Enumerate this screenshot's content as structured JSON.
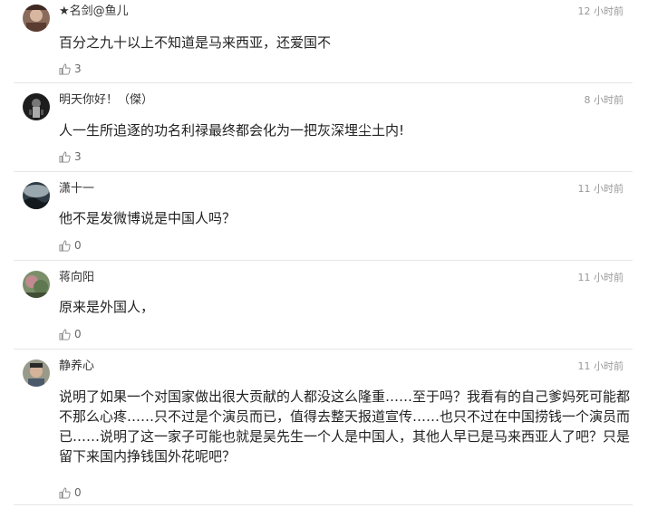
{
  "comments": [
    {
      "username": "★名剑@鱼儿",
      "time": "12 小时前",
      "content": "百分之九十以上不知道是马来西亚，还爱国不",
      "likes": "3",
      "avatar_icon": "avatar-photo"
    },
    {
      "username": "明天你好！（傑）",
      "time": "8 小时前",
      "content": "人一生所追逐的功名利禄最终都会化为一把灰深埋尘土内!",
      "likes": "3",
      "avatar_icon": "avatar-photo"
    },
    {
      "username": "潇十一",
      "time": "11 小时前",
      "content": "他不是发微博说是中国人吗？",
      "likes": "0",
      "avatar_icon": "avatar-photo"
    },
    {
      "username": "蒋向阳",
      "time": "11 小时前",
      "content": "原来是外国人，",
      "likes": "0",
      "avatar_icon": "avatar-photo"
    },
    {
      "username": "静养心",
      "time": "11 小时前",
      "content": "说明了如果一个对国家做出很大贡献的人都没这么隆重……至于吗？我看有的自己爹妈死可能都不那么心疼……只不过是个演员而已，值得去整天报道宣传……也只不过在中国捞钱一个演员而已……说明了这一家子可能也就是吴先生一个人是中国人，其他人早已是马来西亚人了吧？只是留下来国内挣钱国外花呢吧？",
      "likes": "0",
      "avatar_icon": "avatar-photo"
    }
  ],
  "icons": {
    "like": "thumbs-up-icon"
  },
  "colors": {
    "text": "#222222",
    "username": "#333333",
    "time": "#999999",
    "divider": "#e6e6e6"
  }
}
